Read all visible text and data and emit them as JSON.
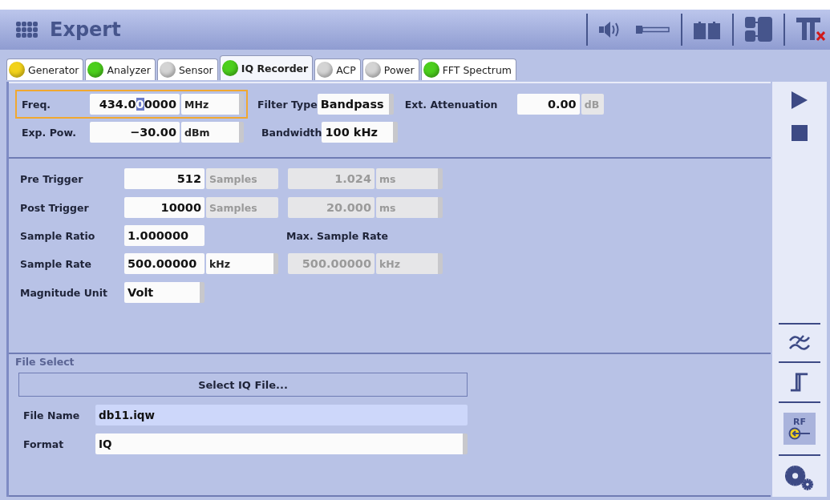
{
  "header": {
    "title": "Expert"
  },
  "tabs": [
    {
      "label": "Generator",
      "color": "#f2d21a",
      "selected": false
    },
    {
      "label": "Analyzer",
      "color": "#4ccf1c",
      "selected": false
    },
    {
      "label": "Sensor",
      "color": "#d4d4d4",
      "selected": false
    },
    {
      "label": "IQ Recorder",
      "color": "#4ccf1c",
      "selected": true
    },
    {
      "label": "ACP",
      "color": "#d4d4d4",
      "selected": false
    },
    {
      "label": "Power",
      "color": "#d4d4d4",
      "selected": false
    },
    {
      "label": "FFT Spectrum",
      "color": "#4ccf1c",
      "selected": false
    }
  ],
  "top": {
    "frequency": {
      "label": "Freq.",
      "value_before_cursor": "434.0",
      "cursor_char": "0",
      "value_after_cursor": "0000",
      "unit": "MHz",
      "focused": true
    },
    "filter_type": {
      "label": "Filter Type",
      "value": "Bandpass"
    },
    "ext_attenuation": {
      "label": "Ext. Attenuation",
      "value": "0.00",
      "unit": "dB",
      "unit_disabled": true
    },
    "exp_power": {
      "label": "Exp. Pow.",
      "value": "−30.00",
      "unit": "dBm"
    },
    "bandwidth": {
      "label": "Bandwidth",
      "value": "100 kHz"
    }
  },
  "trigger": {
    "pre_trigger": {
      "label": "Pre Trigger",
      "value": "512",
      "unit": "Samples",
      "unit_disabled": true,
      "time": "1.024",
      "time_unit": "ms",
      "time_disabled": true
    },
    "post_trigger": {
      "label": "Post Trigger",
      "value": "10000",
      "unit": "Samples",
      "unit_disabled": true,
      "time": "20.000",
      "time_unit": "ms",
      "time_disabled": true
    },
    "sample_ratio": {
      "label": "Sample Ratio",
      "value": "1.000000"
    },
    "max_sample_rate": {
      "label": "Max. Sample Rate",
      "value": "500.00000",
      "unit": "kHz",
      "disabled": true
    },
    "sample_rate": {
      "label": "Sample Rate",
      "value": "500.00000",
      "unit": "kHz"
    },
    "magnitude_unit": {
      "label": "Magnitude Unit",
      "value": "Volt"
    }
  },
  "file": {
    "title": "File Select",
    "button": "Select IQ File...",
    "file_name": {
      "label": "File Name",
      "value": "db11.iqw"
    },
    "format": {
      "label": "Format",
      "value": "IQ"
    }
  },
  "side_toolbar": {
    "rf_label": "RF"
  }
}
